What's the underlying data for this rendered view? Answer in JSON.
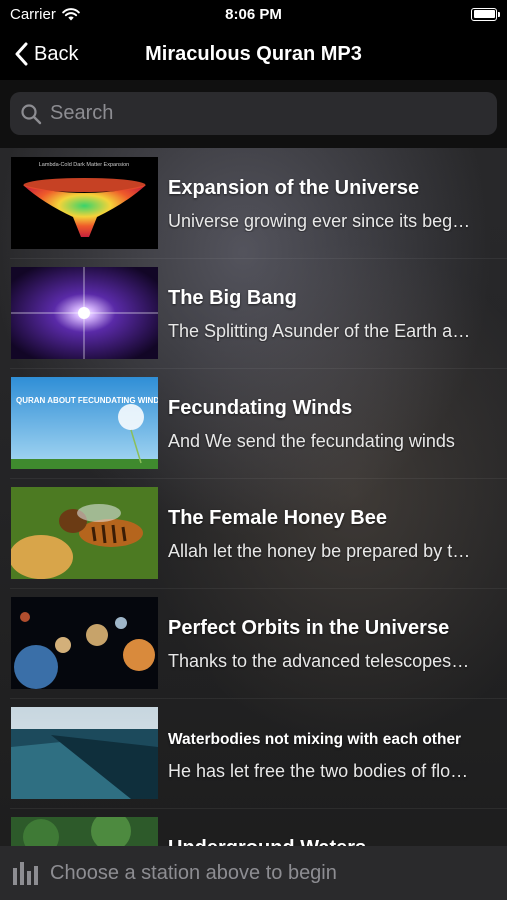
{
  "status_bar": {
    "carrier": "Carrier",
    "time": "8:06 PM"
  },
  "nav": {
    "back_label": "Back",
    "title": "Miraculous Quran MP3"
  },
  "search": {
    "placeholder": "Search"
  },
  "items": [
    {
      "title": "Expansion of the Universe",
      "subtitle": "Universe growing ever since its beginning",
      "thumb_caption": "Lambda-Cold Dark Matter Expansion"
    },
    {
      "title": "The Big Bang",
      "subtitle": "The Splitting Asunder of the Earth and Heavens"
    },
    {
      "title": "Fecundating Winds",
      "subtitle": "And We send the fecundating winds",
      "thumb_caption": "QURAN ABOUT FECUNDATING WIND"
    },
    {
      "title": "The Female Honey Bee",
      "subtitle": "Allah let the honey be prepared by the female bee"
    },
    {
      "title": "Perfect Orbits in the Universe",
      "subtitle": "Thanks to the advanced telescopes of today"
    },
    {
      "title": "Waterbodies not mixing with each other",
      "subtitle": "He has let free the two bodies of flowing water"
    },
    {
      "title": "Underground Waters",
      "subtitle": ""
    }
  ],
  "player": {
    "prompt": "Choose a station above to begin"
  }
}
